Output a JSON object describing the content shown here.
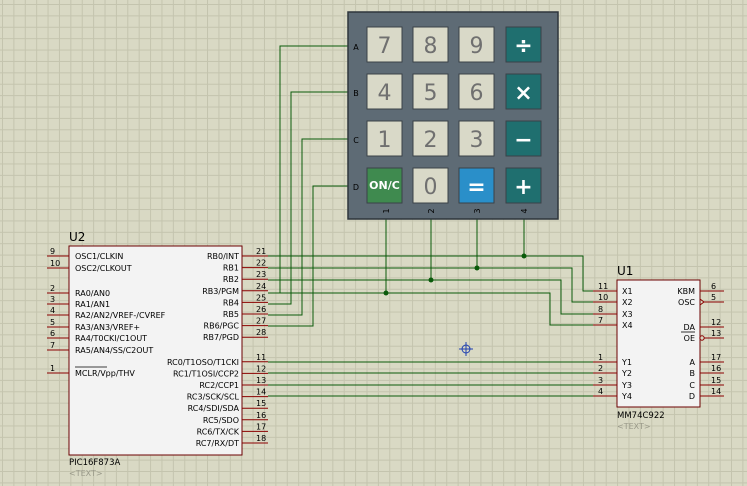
{
  "keypad": {
    "row_labels": [
      "A",
      "B",
      "C",
      "D"
    ],
    "col_labels": [
      "1",
      "2",
      "3",
      "4"
    ],
    "keys": [
      {
        "label": "7",
        "style": "num"
      },
      {
        "label": "8",
        "style": "num"
      },
      {
        "label": "9",
        "style": "num"
      },
      {
        "label": "÷",
        "style": "op"
      },
      {
        "label": "4",
        "style": "num"
      },
      {
        "label": "5",
        "style": "num"
      },
      {
        "label": "6",
        "style": "num"
      },
      {
        "label": "×",
        "style": "op"
      },
      {
        "label": "1",
        "style": "num"
      },
      {
        "label": "2",
        "style": "num"
      },
      {
        "label": "3",
        "style": "num"
      },
      {
        "label": "−",
        "style": "op"
      },
      {
        "label": "ON/C",
        "style": "on"
      },
      {
        "label": "0",
        "style": "num"
      },
      {
        "label": "=",
        "style": "eq"
      },
      {
        "label": "+",
        "style": "op"
      }
    ]
  },
  "u2": {
    "ref": "U2",
    "part": "PIC16F873A",
    "text": "<TEXT>",
    "left_pins": [
      {
        "num": "9",
        "name": "OSC1/CLKIN"
      },
      {
        "num": "10",
        "name": "OSC2/CLKOUT"
      },
      {
        "num": "2",
        "name": "RA0/AN0"
      },
      {
        "num": "3",
        "name": "RA1/AN1"
      },
      {
        "num": "4",
        "name": "RA2/AN2/VREF-/CVREF"
      },
      {
        "num": "5",
        "name": "RA3/AN3/VREF+"
      },
      {
        "num": "6",
        "name": "RA4/T0CKI/C1OUT"
      },
      {
        "num": "7",
        "name": "RA5/AN4/SS/C2OUT"
      },
      {
        "num": "1",
        "name": "MCLR/Vpp/THV"
      }
    ],
    "right_pins": [
      {
        "num": "21",
        "name": "RB0/INT"
      },
      {
        "num": "22",
        "name": "RB1"
      },
      {
        "num": "23",
        "name": "RB2"
      },
      {
        "num": "24",
        "name": "RB3/PGM"
      },
      {
        "num": "25",
        "name": "RB4"
      },
      {
        "num": "26",
        "name": "RB5"
      },
      {
        "num": "27",
        "name": "RB6/PGC"
      },
      {
        "num": "28",
        "name": "RB7/PGD"
      },
      {
        "num": "11",
        "name": "RC0/T1OSO/T1CKI"
      },
      {
        "num": "12",
        "name": "RC1/T1OSI/CCP2"
      },
      {
        "num": "13",
        "name": "RC2/CCP1"
      },
      {
        "num": "14",
        "name": "RC3/SCK/SCL"
      },
      {
        "num": "15",
        "name": "RC4/SDI/SDA"
      },
      {
        "num": "16",
        "name": "RC5/SDO"
      },
      {
        "num": "17",
        "name": "RC6/TX/CK"
      },
      {
        "num": "18",
        "name": "RC7/RX/DT"
      }
    ]
  },
  "u1": {
    "ref": "U1",
    "part": "MM74C922",
    "text": "<TEXT>",
    "left_pins": [
      {
        "num": "11",
        "name": "X1"
      },
      {
        "num": "10",
        "name": "X2"
      },
      {
        "num": "8",
        "name": "X3"
      },
      {
        "num": "7",
        "name": "X4"
      },
      {
        "num": "1",
        "name": "Y1"
      },
      {
        "num": "2",
        "name": "Y2"
      },
      {
        "num": "3",
        "name": "Y3"
      },
      {
        "num": "4",
        "name": "Y4"
      }
    ],
    "right_pins": [
      {
        "num": "6",
        "name": "KBM"
      },
      {
        "num": "5",
        "name": "OSC"
      },
      {
        "num": "12",
        "name": "DA"
      },
      {
        "num": "13",
        "name": "OE"
      },
      {
        "num": "17",
        "name": "A"
      },
      {
        "num": "16",
        "name": "B"
      },
      {
        "num": "15",
        "name": "C"
      },
      {
        "num": "14",
        "name": "D"
      }
    ]
  },
  "colors": {
    "wire": "#0a5a0a",
    "pin": "#8b0000",
    "chip_fill": "#f3f3f3",
    "keypad_body": "#5e6b75",
    "key_num": "#d9d9c8",
    "key_op": "#1f6f6f",
    "key_eq": "#2a8fc9",
    "key_on": "#3f8a4f"
  }
}
